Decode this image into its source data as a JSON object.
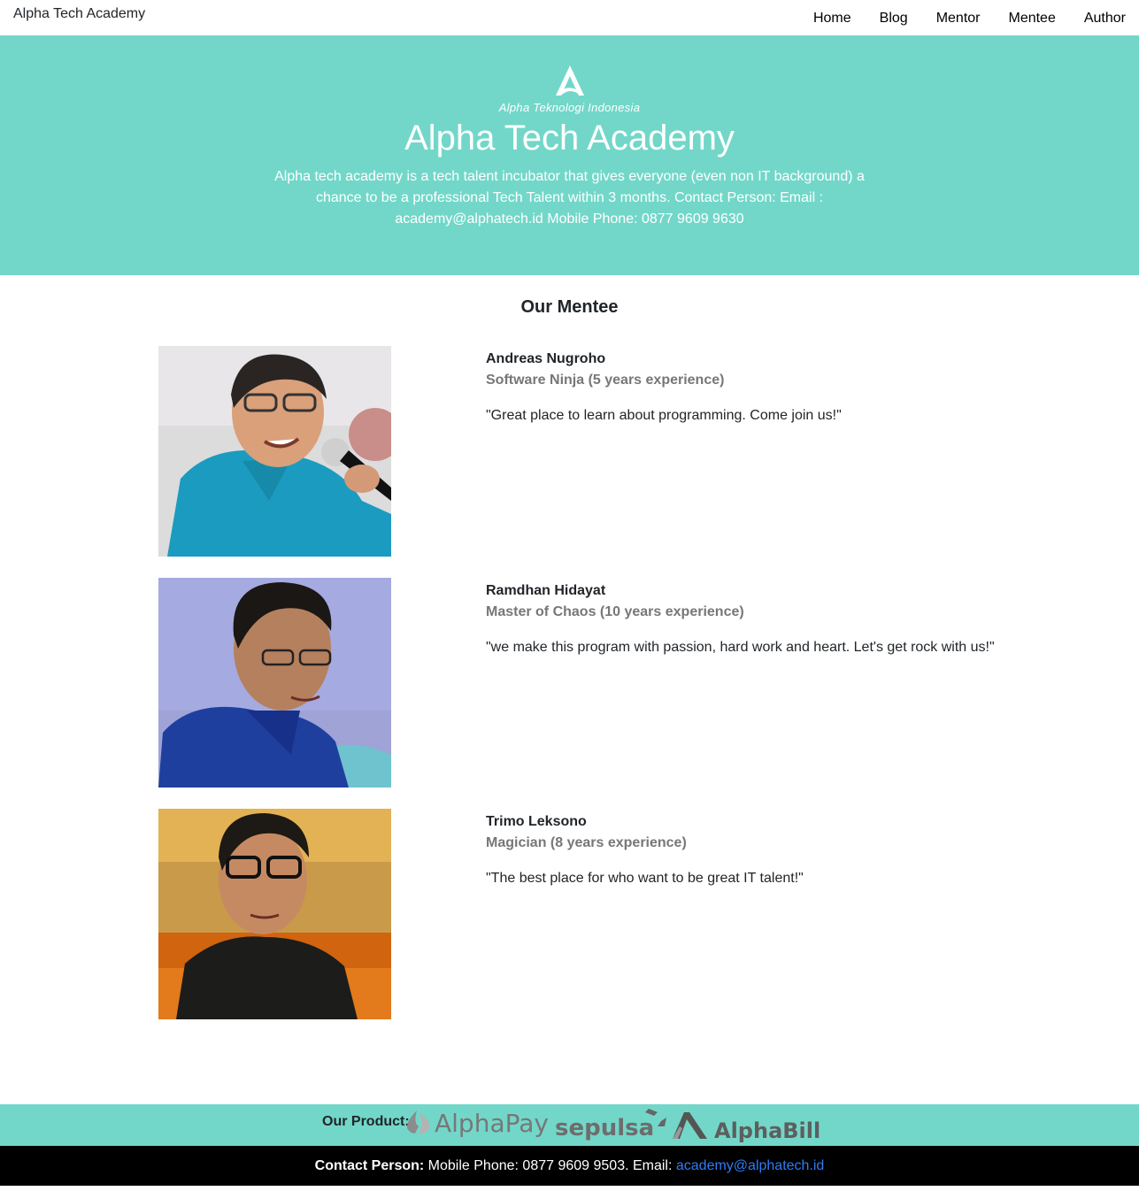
{
  "navbar": {
    "brand": "Alpha Tech Academy",
    "links": [
      "Home",
      "Blog",
      "Mentor",
      "Mentee",
      "Author"
    ]
  },
  "hero": {
    "logo_text": "Alpha Teknologi Indonesia",
    "title": "Alpha Tech Academy",
    "description": "Alpha tech academy is a tech talent incubator that gives everyone (even non IT background) a chance to be a professional Tech Talent within 3 months. Contact Person: Email : academy@alphatech.id Mobile Phone: 0877 9609 9630"
  },
  "section": {
    "title": "Our Mentee"
  },
  "mentees": [
    {
      "name": "Andreas Nugroho",
      "role": "Software Ninja (5 years experience)",
      "quote": "\"Great place to learn about programming. Come join us!\""
    },
    {
      "name": "Ramdhan Hidayat",
      "role": "Master of Chaos (10 years experience)",
      "quote": "\"we make this program with passion, hard work and heart. Let's get rock with us!\""
    },
    {
      "name": "Trimo Leksono",
      "role": "Magician (8 years experience)",
      "quote": "\"The best place for who want to be great IT talent!\""
    }
  ],
  "footer": {
    "products_label": "Our Product:",
    "product_names": [
      "AlphaPay",
      "sepulsa",
      "AlphaBill"
    ],
    "contact_label": "Contact Person:",
    "contact_text": " Mobile Phone: 0877 9609 9503. Email: ",
    "contact_email": "academy@alphatech.id"
  },
  "colors": {
    "accent": "#72d7c9",
    "role_gray": "#777777",
    "link": "#2e7cf6"
  }
}
